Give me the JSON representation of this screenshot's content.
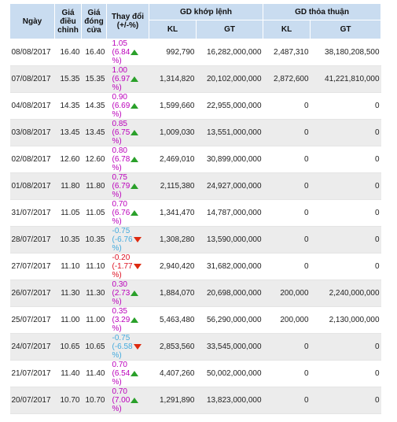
{
  "headers": {
    "date": "Ngày",
    "adj_price": "Giá điều chỉnh",
    "close_price": "Giá đóng cửa",
    "change": "Thay đổi (+/-%)",
    "matched_group": "GD khớp lệnh",
    "deal_group": "GD thỏa thuận",
    "kl": "KL",
    "gt": "GT"
  },
  "colors": {
    "header_bg": "#c9dcf0",
    "up": "#bb00bb",
    "down": "#dd1122",
    "ref": "#22aa22",
    "arrow_up": "#2aa02a",
    "arrow_down": "#dd2a10"
  },
  "rows": [
    {
      "date": "08/08/2017",
      "adj": "16.40",
      "close": "16.40",
      "chg": "1.05",
      "pct": "(6.84",
      "dir": "up",
      "kl": "992,790",
      "gt": "16,282,000,000",
      "tkl": "2,487,310",
      "tgt": "38,180,208,500"
    },
    {
      "date": "07/08/2017",
      "adj": "15.35",
      "close": "15.35",
      "chg": "1.00",
      "pct": "(6.97",
      "dir": "up",
      "kl": "1,314,820",
      "gt": "20,102,000,000",
      "tkl": "2,872,600",
      "tgt": "41,221,810,000"
    },
    {
      "date": "04/08/2017",
      "adj": "14.35",
      "close": "14.35",
      "chg": "0.90",
      "pct": "(6.69",
      "dir": "up",
      "kl": "1,599,660",
      "gt": "22,955,000,000",
      "tkl": "0",
      "tgt": "0"
    },
    {
      "date": "03/08/2017",
      "adj": "13.45",
      "close": "13.45",
      "chg": "0.85",
      "pct": "(6.75",
      "dir": "up",
      "kl": "1,009,030",
      "gt": "13,551,000,000",
      "tkl": "0",
      "tgt": "0"
    },
    {
      "date": "02/08/2017",
      "adj": "12.60",
      "close": "12.60",
      "chg": "0.80",
      "pct": "(6.78",
      "dir": "up",
      "kl": "2,469,010",
      "gt": "30,899,000,000",
      "tkl": "0",
      "tgt": "0"
    },
    {
      "date": "01/08/2017",
      "adj": "11.80",
      "close": "11.80",
      "chg": "0.75",
      "pct": "(6.79",
      "dir": "up",
      "kl": "2,115,380",
      "gt": "24,927,000,000",
      "tkl": "0",
      "tgt": "0"
    },
    {
      "date": "31/07/2017",
      "adj": "11.05",
      "close": "11.05",
      "chg": "0.70",
      "pct": "(6.76",
      "dir": "up",
      "kl": "1,341,470",
      "gt": "14,787,000,000",
      "tkl": "0",
      "tgt": "0"
    },
    {
      "date": "28/07/2017",
      "adj": "10.35",
      "close": "10.35",
      "chg": "-0.75",
      "pct": "6.76",
      "dir": "down",
      "kl": "1,308,280",
      "gt": "13,590,000,000",
      "tkl": "0",
      "tgt": "0"
    },
    {
      "date": "27/07/2017",
      "adj": "11.10",
      "close": "11.10",
      "chg": "-0.20",
      "pct": "1.77",
      "dir": "down",
      "kl": "2,940,420",
      "gt": "31,682,000,000",
      "tkl": "0",
      "tgt": "0"
    },
    {
      "date": "26/07/2017",
      "adj": "11.30",
      "close": "11.30",
      "chg": "0.30",
      "pct": "(2.73",
      "dir": "up",
      "kl": "1,884,070",
      "gt": "20,698,000,000",
      "tkl": "200,000",
      "tgt": "2,240,000,000"
    },
    {
      "date": "25/07/2017",
      "adj": "11.00",
      "close": "11.00",
      "chg": "0.35",
      "pct": "(3.29",
      "dir": "up",
      "kl": "5,463,480",
      "gt": "56,290,000,000",
      "tkl": "200,000",
      "tgt": "2,130,000,000"
    },
    {
      "date": "24/07/2017",
      "adj": "10.65",
      "close": "10.65",
      "chg": "-0.75",
      "pct": "6.58",
      "dir": "down",
      "kl": "2,853,560",
      "gt": "33,545,000,000",
      "tkl": "0",
      "tgt": "0"
    },
    {
      "date": "21/07/2017",
      "adj": "11.40",
      "close": "11.40",
      "chg": "0.70",
      "pct": "(6.54",
      "dir": "up",
      "kl": "4,407,260",
      "gt": "50,002,000,000",
      "tkl": "0",
      "tgt": "0"
    },
    {
      "date": "20/07/2017",
      "adj": "10.70",
      "close": "10.70",
      "chg": "0.70",
      "pct": "(7.00",
      "dir": "up",
      "kl": "1,291,890",
      "gt": "13,823,000,000",
      "tkl": "0",
      "tgt": "0"
    }
  ],
  "row_colors": [
    "ref",
    "ref",
    "ref",
    "ref",
    "ref",
    "up",
    "up",
    "down",
    "down",
    "ref",
    "ref",
    "down",
    "up",
    "up"
  ]
}
